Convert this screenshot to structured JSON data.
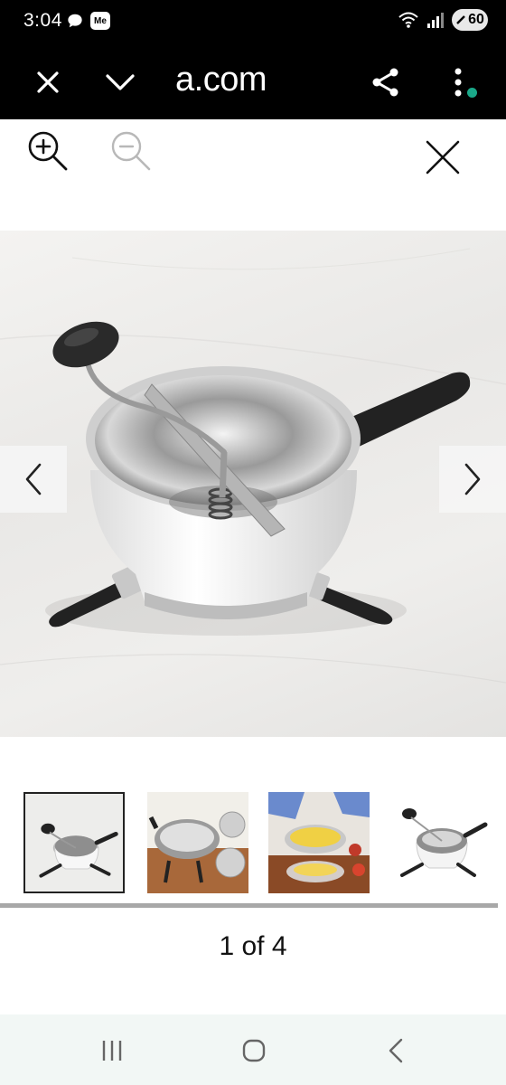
{
  "status_bar": {
    "time": "3:04",
    "me_badge": "Me",
    "battery": "60",
    "icons": [
      "chat-bubble-icon",
      "me-app-icon",
      "wifi-icon",
      "signal-icon",
      "battery-icon"
    ]
  },
  "toolbar": {
    "url": "a.com",
    "close_icon": "close-icon",
    "chevron_icon": "chevron-down-icon",
    "share_icon": "share-icon",
    "more_icon": "more-vert-icon",
    "notify_color": "#1aa889"
  },
  "viewer": {
    "zoom_in_icon": "zoom-in-icon",
    "zoom_out_icon": "zoom-out-icon",
    "close_icon": "close-icon",
    "prev_icon": "chevron-left-icon",
    "next_icon": "chevron-right-icon",
    "thumbnails": [
      {
        "selected": true
      },
      {
        "selected": false
      },
      {
        "selected": false
      },
      {
        "selected": false
      }
    ],
    "counter": "1 of 4",
    "scroll_fraction": 1.0
  },
  "nav_bar": {
    "recents_icon": "recents-icon",
    "home_icon": "home-icon",
    "back_icon": "back-icon"
  }
}
